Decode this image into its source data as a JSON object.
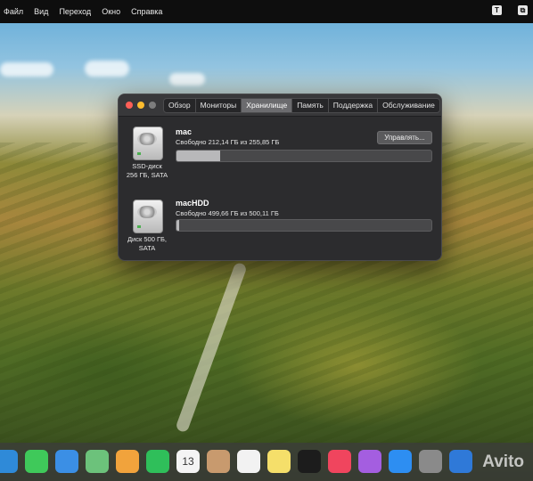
{
  "menubar": {
    "items": [
      "Файл",
      "Вид",
      "Переход",
      "Окно",
      "Справка"
    ],
    "right_icons": [
      {
        "name": "text-input-icon",
        "glyph": "T"
      },
      {
        "name": "control-center-icon",
        "glyph": "⧉"
      }
    ]
  },
  "window": {
    "tabs": [
      {
        "label": "Обзор",
        "active": false
      },
      {
        "label": "Мониторы",
        "active": false
      },
      {
        "label": "Хранилище",
        "active": true
      },
      {
        "label": "Память",
        "active": false
      },
      {
        "label": "Поддержка",
        "active": false
      },
      {
        "label": "Обслуживание",
        "active": false
      }
    ],
    "drives": [
      {
        "volume_name": "mac",
        "free_text": "Свободно 212,14 ГБ из 255,85 ГБ",
        "caption_line1": "SSD-диск",
        "caption_line2": "256 ГБ, SATA",
        "used_fraction": 0.17,
        "button_label": "Управлять..."
      },
      {
        "volume_name": "macHDD",
        "free_text": "Свободно 499,66 ГБ из 500,11 ГБ",
        "caption_line1": "Диск 500 ГБ,",
        "caption_line2": "SATA",
        "used_fraction": 0.01
      }
    ]
  },
  "dock": {
    "calendar_day": "13",
    "apps": [
      {
        "name": "safari-icon",
        "color": "#2f8ad8"
      },
      {
        "name": "messages-icon",
        "color": "#3fc95a"
      },
      {
        "name": "mail-icon",
        "color": "#3b8fe5"
      },
      {
        "name": "maps-icon",
        "color": "#6cc27b"
      },
      {
        "name": "photos-icon",
        "color": "#f1a33c"
      },
      {
        "name": "facetime-icon",
        "color": "#2fbf5a"
      },
      {
        "name": "calendar-icon",
        "color": "#f4f4f4"
      },
      {
        "name": "contacts-icon",
        "color": "#c89a6e"
      },
      {
        "name": "reminders-icon",
        "color": "#f2f2f2"
      },
      {
        "name": "notes-icon",
        "color": "#f5df6a"
      },
      {
        "name": "tv-icon",
        "color": "#1c1c1c"
      },
      {
        "name": "music-icon",
        "color": "#f0455e"
      },
      {
        "name": "podcasts-icon",
        "color": "#a45ee0"
      },
      {
        "name": "app-store-icon",
        "color": "#2d8ef2"
      },
      {
        "name": "system-preferences-icon",
        "color": "#8a8a8a"
      },
      {
        "name": "keynote-icon",
        "color": "#2f79d8"
      }
    ]
  },
  "watermark": "Avito"
}
